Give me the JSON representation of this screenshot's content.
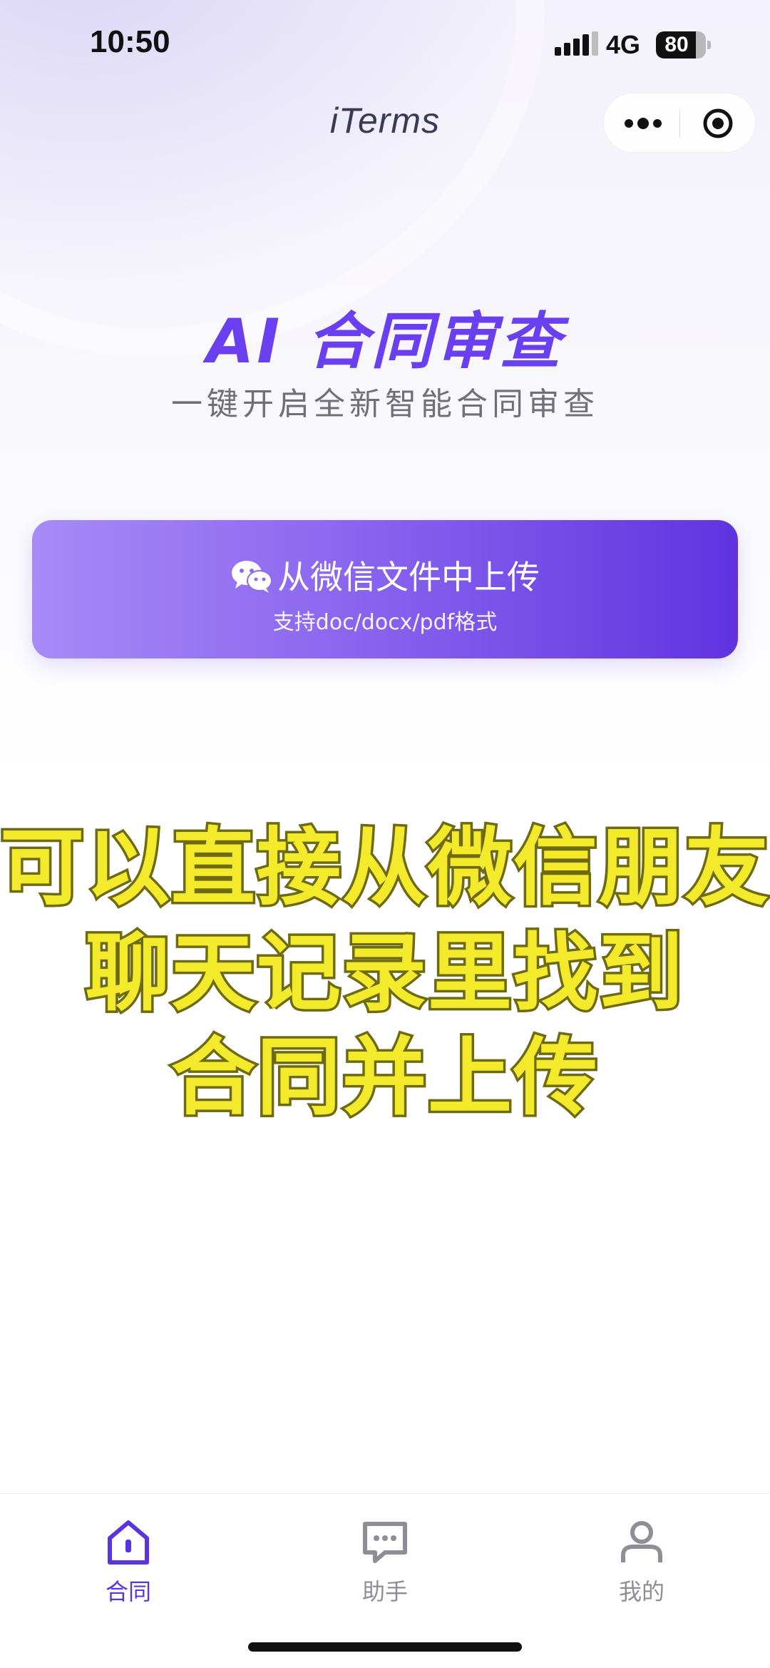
{
  "status_bar": {
    "time": "10:50",
    "network": "4G",
    "battery": "80",
    "battery_level": 0.8
  },
  "nav": {
    "title": "iTerms"
  },
  "hero": {
    "title": "AI 合同审查",
    "subtitle": "一键开启全新智能合同审查"
  },
  "upload": {
    "label": "从微信文件中上传",
    "formats": "支持doc/docx/pdf格式",
    "icon": "wechat-icon"
  },
  "caption": {
    "line1": "可以直接从微信朋友",
    "line2": "聊天记录里找到",
    "line3": "合同并上传"
  },
  "tabs": [
    {
      "label": "合同",
      "icon": "home-icon",
      "active": true
    },
    {
      "label": "助手",
      "icon": "chat-icon",
      "active": false
    },
    {
      "label": "我的",
      "icon": "user-icon",
      "active": false
    }
  ],
  "colors": {
    "accent": "#5a34e0",
    "caption_fill": "#f4ea2c",
    "caption_stroke": "#6e6a10",
    "inactive": "#8e8e96"
  }
}
